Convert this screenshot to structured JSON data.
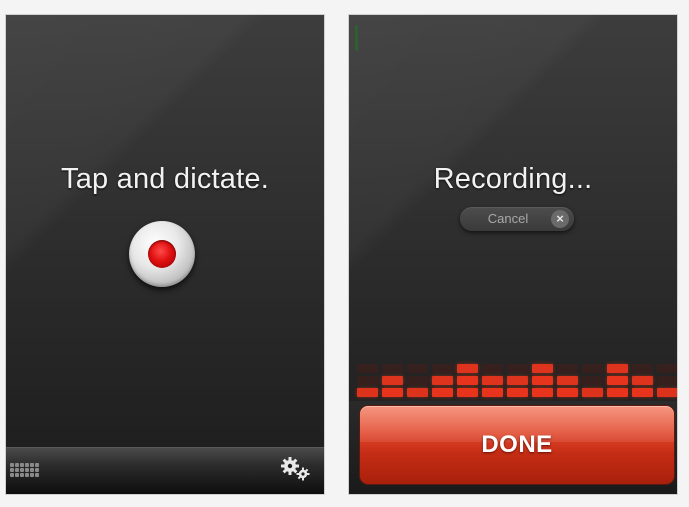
{
  "left_screen": {
    "headline": "Tap and dictate.",
    "record_button_icon": "record-icon",
    "toolbar": {
      "keyboard_icon": "keyboard-icon",
      "settings_icon": "gears-icon"
    }
  },
  "right_screen": {
    "headline": "Recording...",
    "cancel_label": "Cancel",
    "cancel_icon": "close-icon",
    "done_label": "DONE",
    "level_meter": {
      "columns": 13,
      "levels": [
        1,
        2,
        1,
        2,
        3,
        2,
        2,
        3,
        2,
        1,
        3,
        2,
        1
      ],
      "max_level": 3
    }
  },
  "colors": {
    "record_red": "#e01010",
    "meter_active": "#e8341c",
    "meter_dim": "#5a1a12",
    "done_button": "#d63a1f"
  }
}
